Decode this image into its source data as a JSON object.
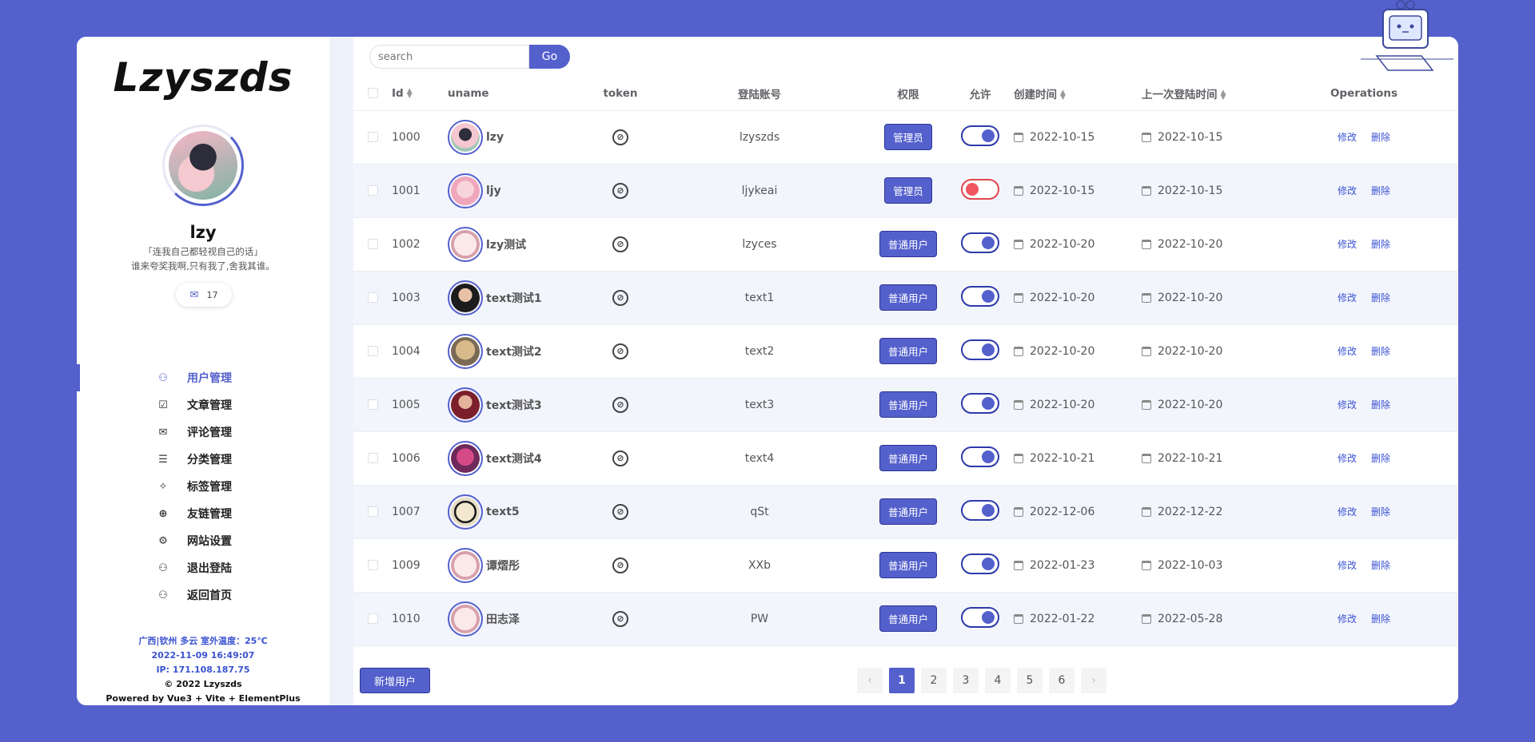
{
  "brand": {
    "logo": "Lzyszds",
    "accent": "#5460cc"
  },
  "profile": {
    "name": "lzy",
    "motto_line1": "「连我自己都轻视自己的话」",
    "motto_line2": "谁来夸奖我啊,只有我了,舍我其谁。",
    "message_count": "17"
  },
  "nav": [
    {
      "label": "用户管理",
      "icon": "user-icon",
      "active": true
    },
    {
      "label": "文章管理",
      "icon": "edit-icon"
    },
    {
      "label": "评论管理",
      "icon": "mail-icon"
    },
    {
      "label": "分类管理",
      "icon": "list-icon"
    },
    {
      "label": "标签管理",
      "icon": "tags-icon"
    },
    {
      "label": "友链管理",
      "icon": "globe-icon"
    },
    {
      "label": "网站设置",
      "icon": "settings-icon"
    },
    {
      "label": "退出登陆",
      "icon": "logout-user-icon"
    },
    {
      "label": "返回首页",
      "icon": "home-user-icon"
    }
  ],
  "footer": {
    "weather": "广西|钦州 多云 室外温度：25℃",
    "datetime": "2022-11-09 16:49:07",
    "ip": "IP: 171.108.187.75",
    "copyright": "© 2022 Lzyszds",
    "powered": "Powered by Vue3 + Vite + ElementPlus"
  },
  "search": {
    "placeholder": "search",
    "button": "Go"
  },
  "table": {
    "headers": {
      "id": "Id",
      "uname": "uname",
      "token": "token",
      "account": "登陆账号",
      "role": "权限",
      "allow": "允许",
      "created": "创建时间",
      "last_login": "上一次登陆时间",
      "ops": "Operations"
    },
    "rows": [
      {
        "id": "1000",
        "uname": "lzy",
        "account": "lzyszds",
        "role": "管理员",
        "allow": true,
        "created": "2022-10-15",
        "last": "2022-10-15"
      },
      {
        "id": "1001",
        "uname": "ljy",
        "account": "ljykeai",
        "role": "管理员",
        "allow": false,
        "created": "2022-10-15",
        "last": "2022-10-15"
      },
      {
        "id": "1002",
        "uname": "lzy测试",
        "account": "lzyces",
        "role": "普通用户",
        "allow": true,
        "created": "2022-10-20",
        "last": "2022-10-20"
      },
      {
        "id": "1003",
        "uname": "text测试1",
        "account": "text1",
        "role": "普通用户",
        "allow": true,
        "created": "2022-10-20",
        "last": "2022-10-20"
      },
      {
        "id": "1004",
        "uname": "text测试2",
        "account": "text2",
        "role": "普通用户",
        "allow": true,
        "created": "2022-10-20",
        "last": "2022-10-20"
      },
      {
        "id": "1005",
        "uname": "text测试3",
        "account": "text3",
        "role": "普通用户",
        "allow": true,
        "created": "2022-10-20",
        "last": "2022-10-20"
      },
      {
        "id": "1006",
        "uname": "text测试4",
        "account": "text4",
        "role": "普通用户",
        "allow": true,
        "created": "2022-10-21",
        "last": "2022-10-21"
      },
      {
        "id": "1007",
        "uname": "text5",
        "account": "qSt",
        "role": "普通用户",
        "allow": true,
        "created": "2022-12-06",
        "last": "2022-12-22"
      },
      {
        "id": "1009",
        "uname": "谭熠彤",
        "account": "XXb",
        "role": "普通用户",
        "allow": true,
        "created": "2022-01-23",
        "last": "2022-10-03"
      },
      {
        "id": "1010",
        "uname": "田志泽",
        "account": "PW",
        "role": "普通用户",
        "allow": true,
        "created": "2022-01-22",
        "last": "2022-05-28"
      }
    ],
    "edit_label": "修改",
    "delete_label": "删除"
  },
  "add_user": "新增用户",
  "pagination": {
    "prev": "‹",
    "next": "›",
    "pages": [
      "1",
      "2",
      "3",
      "4",
      "5",
      "6"
    ],
    "current": "1"
  }
}
